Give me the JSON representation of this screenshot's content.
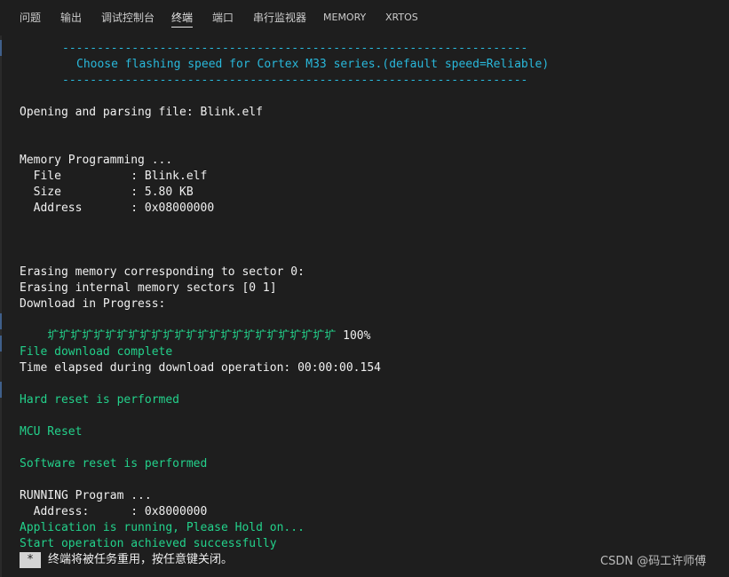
{
  "tabs": [
    {
      "label": "问题"
    },
    {
      "label": "输出"
    },
    {
      "label": "调试控制台"
    },
    {
      "label": "终端",
      "active": true
    },
    {
      "label": "端口"
    },
    {
      "label": "串行监视器"
    },
    {
      "label": "MEMORY"
    },
    {
      "label": "XRTOS"
    }
  ],
  "terminal": {
    "separator_top": "-------------------------------------------------------------------",
    "speed_prompt": "Choose flashing speed for Cortex M33 series.(default speed=Reliable)",
    "separator_bottom": "-------------------------------------------------------------------",
    "opening_file": "Opening and parsing file: Blink.elf",
    "memory_programming": "Memory Programming ...",
    "file_line": "  File          : Blink.elf",
    "size_line": "  Size          : 5.80 KB",
    "address_line": "  Address       : 0x08000000",
    "erasing_sector": "Erasing memory corresponding to sector 0:",
    "erasing_internal": "Erasing internal memory sectors [0 1]",
    "download_progress": "Download in Progress:",
    "progress_glyphs": "圹圹圹圹圹圹圹圹圹圹圹圹圹圹圹圹圹圹圹圹圹圹圹圹圹",
    "progress_percent": " 100%",
    "download_complete": "File download complete",
    "time_elapsed": "Time elapsed during download operation: 00:00:00.154",
    "hard_reset": "Hard reset is performed",
    "mcu_reset": "MCU Reset",
    "software_reset": "Software reset is performed",
    "running_program": "RUNNING Program ...",
    "run_address": "  Address:      : 0x8000000",
    "app_running": "Application is running, Please Hold on...",
    "start_success": "Start operation achieved successfully"
  },
  "footer": {
    "star": "*",
    "reuse_message": "终端将被任务重用，按任意键关闭。",
    "watermark": "CSDN @码工许师傅"
  },
  "colors": {
    "background": "#1e1e1e",
    "cyan": "#29b8db",
    "green": "#23d18b",
    "text": "#f0f0f0"
  }
}
